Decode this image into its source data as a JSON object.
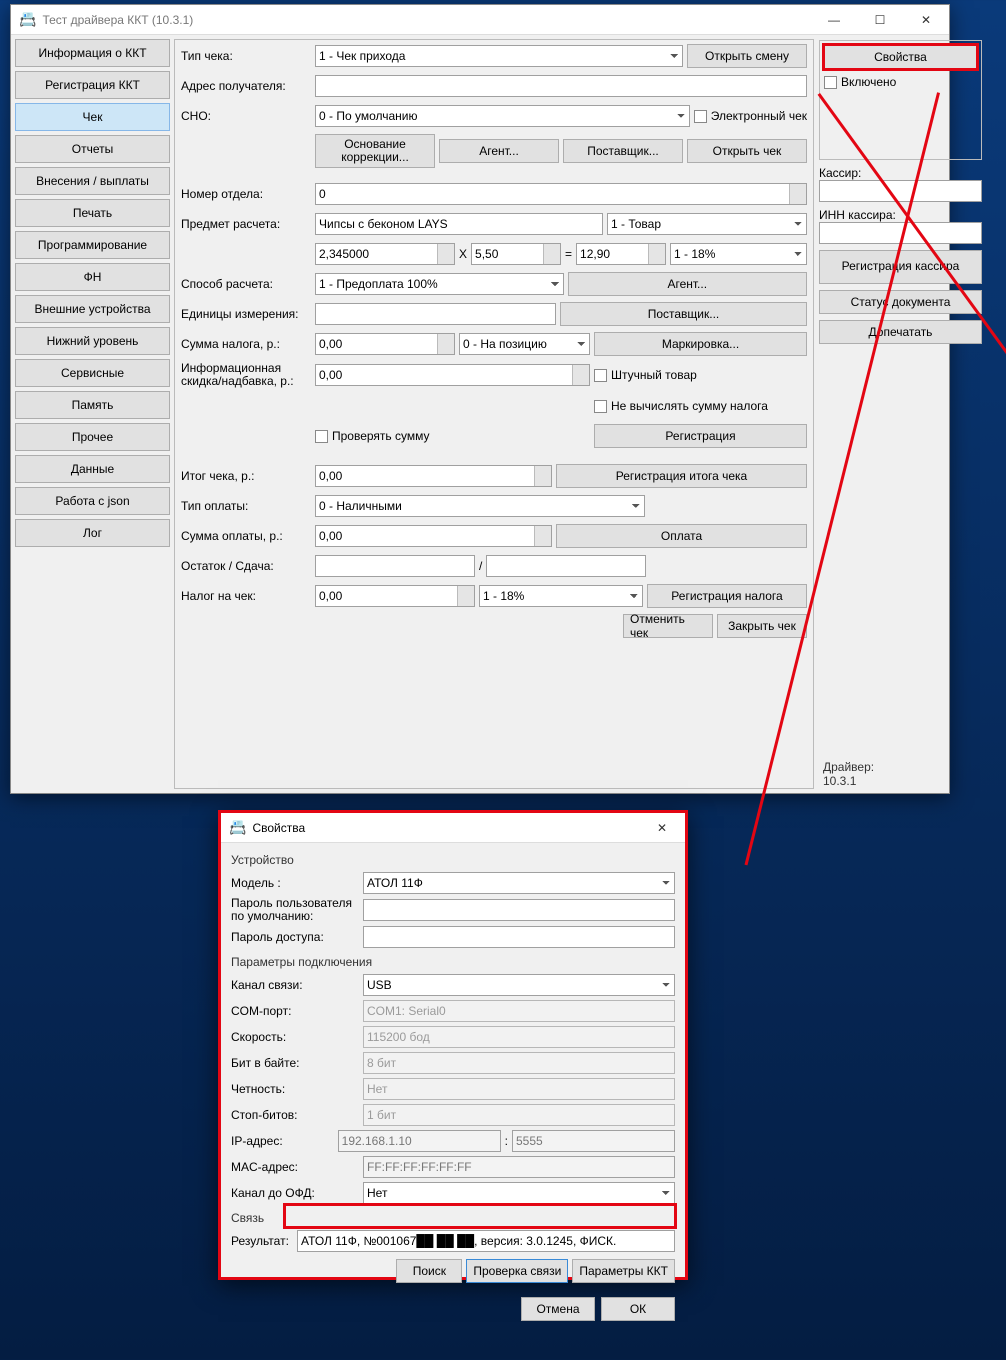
{
  "main": {
    "title": "Тест драйвера ККТ (10.3.1)",
    "nav": [
      "Информация о ККТ",
      "Регистрация ККТ",
      "Чек",
      "Отчеты",
      "Внесения / выплаты",
      "Печать",
      "Программирование",
      "ФН",
      "Внешние устройства",
      "Нижний уровень",
      "Сервисные",
      "Память",
      "Прочее",
      "Данные",
      "Работа с json",
      "Лог"
    ],
    "nav_active": "Чек",
    "labels": {
      "type": "Тип чека:",
      "addr": "Адрес получателя:",
      "sno": "СНО:",
      "open_shift": "Открыть смену",
      "electronic": "Электронный чек",
      "corr_basis": "Основание коррекции...",
      "agent": "Агент...",
      "supplier": "Поставщик...",
      "open_receipt": "Открыть чек",
      "dept": "Номер отдела:",
      "item": "Предмет расчета:",
      "calc_method": "Способ расчета:",
      "units": "Единицы измерения:",
      "tax_sum": "Сумма налога, р.:",
      "info_disc": "Информационная скидка/надбавка, р.:",
      "tax_pos": "0 - На позицию",
      "btn_supplier2": "Поставщик...",
      "btn_agent2": "Агент...",
      "btn_marking": "Маркировка...",
      "piece": "Штучный товар",
      "no_tax_calc": "Не вычислять сумму налога",
      "check_sum": "Проверять сумму",
      "register": "Регистрация",
      "total": "Итог чека, р.:",
      "pay_type": "Тип оплаты:",
      "pay_sum": "Сумма оплаты, р.:",
      "remainder": "Остаток / Сдача:",
      "tax_receipt": "Налог на чек:",
      "reg_total": "Регистрация итога чека",
      "payment": "Оплата",
      "reg_tax": "Регистрация налога",
      "cancel_receipt": "Отменить чек",
      "close_receipt": "Закрыть чек"
    },
    "values": {
      "type_sel": "1 - Чек прихода",
      "addr": "",
      "sno_sel": "0 - По умолчанию",
      "dept": "0",
      "item_name": "Чипсы с беконом LAYS",
      "item_cat": "1 - Товар",
      "qty": "2,345000",
      "mul": "X",
      "price": "5,50",
      "eq": "=",
      "total_line": "12,90",
      "tax_rate_line": "1 - 18%",
      "calc_method_sel": "1 - Предоплата 100%",
      "units": "",
      "tax_sum": "0,00",
      "info_disc": "0,00",
      "total": "0,00",
      "pay_type_sel": "0 - Наличными",
      "pay_sum": "0,00",
      "remA": "",
      "remB": "",
      "tax_receipt_val": "0,00",
      "tax_receipt_rate": "1 - 18%"
    },
    "right": {
      "properties_btn": "Свойства",
      "enabled_chk": "Включено",
      "cashier": "Кассир:",
      "cashier_val": "",
      "cashier_inn": "ИНН кассира:",
      "cashier_inn_val": "",
      "reg_cashier": "Регистрация кассира",
      "doc_status": "Статус документа",
      "print_more": "Допечатать",
      "driver_lbl": "Драйвер:",
      "driver_ver": "10.3.1"
    }
  },
  "props": {
    "title": "Свойства",
    "sec_device": "Устройство",
    "lbl_model": "Модель :",
    "model": "АТОЛ 11Ф",
    "lbl_user_pwd": "Пароль пользователя по умолчанию:",
    "user_pwd": "",
    "lbl_access_pwd": "Пароль доступа:",
    "access_pwd": "",
    "sec_conn": "Параметры подключения",
    "lbl_channel": "Канал связи:",
    "channel": "USB",
    "lbl_com": "COM-порт:",
    "com": "COM1: Serial0",
    "lbl_speed": "Скорость:",
    "speed": "115200 бод",
    "lbl_bits": "Бит в байте:",
    "bits": "8 бит",
    "lbl_parity": "Четность:",
    "parity": "Нет",
    "lbl_stop": "Стоп-битов:",
    "stop": "1 бит",
    "lbl_ip": "IP-адрес:",
    "ip": "192.168.1.10",
    "port_sep": ":",
    "port": "5555",
    "lbl_mac": "MAC-адрес:",
    "mac": "FF:FF:FF:FF:FF:FF",
    "lbl_ofd": "Канал до ОФД:",
    "ofd": "Нет",
    "sec_link": "Связь",
    "lbl_result": "Результат:",
    "result": "АТОЛ 11Ф, №001067██ ██ ██, версия: 3.0.1245, ФИСК.",
    "btn_search": "Поиск",
    "btn_test": "Проверка связи",
    "btn_params": "Параметры ККТ",
    "btn_cancel": "Отмена",
    "btn_ok": "ОК"
  }
}
